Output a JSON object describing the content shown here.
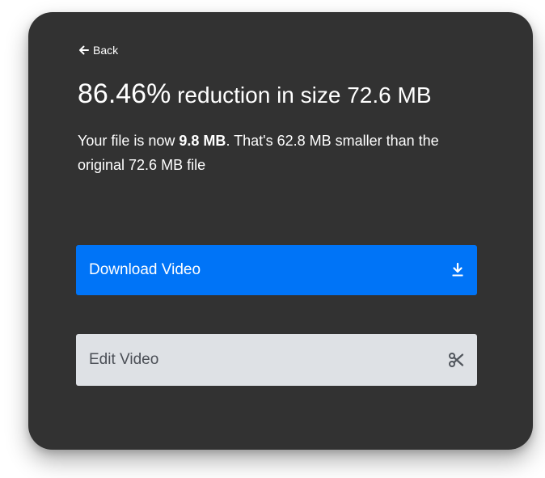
{
  "back": {
    "label": "Back"
  },
  "headline": {
    "percent": "86.46%",
    "rest": " reduction in size 72.6 MB"
  },
  "description": {
    "prefix": "Your file is now ",
    "new_size": "9.8 MB",
    "suffix": ". That's 62.8 MB smaller than the original 72.6 MB file"
  },
  "actions": {
    "download_label": "Download Video",
    "edit_label": "Edit Video"
  },
  "colors": {
    "card_background": "#323232",
    "primary": "#0074f7",
    "secondary": "#dee1e5"
  },
  "icons": {
    "back": "arrow-left-icon",
    "download": "download-icon",
    "edit": "scissors-icon"
  }
}
